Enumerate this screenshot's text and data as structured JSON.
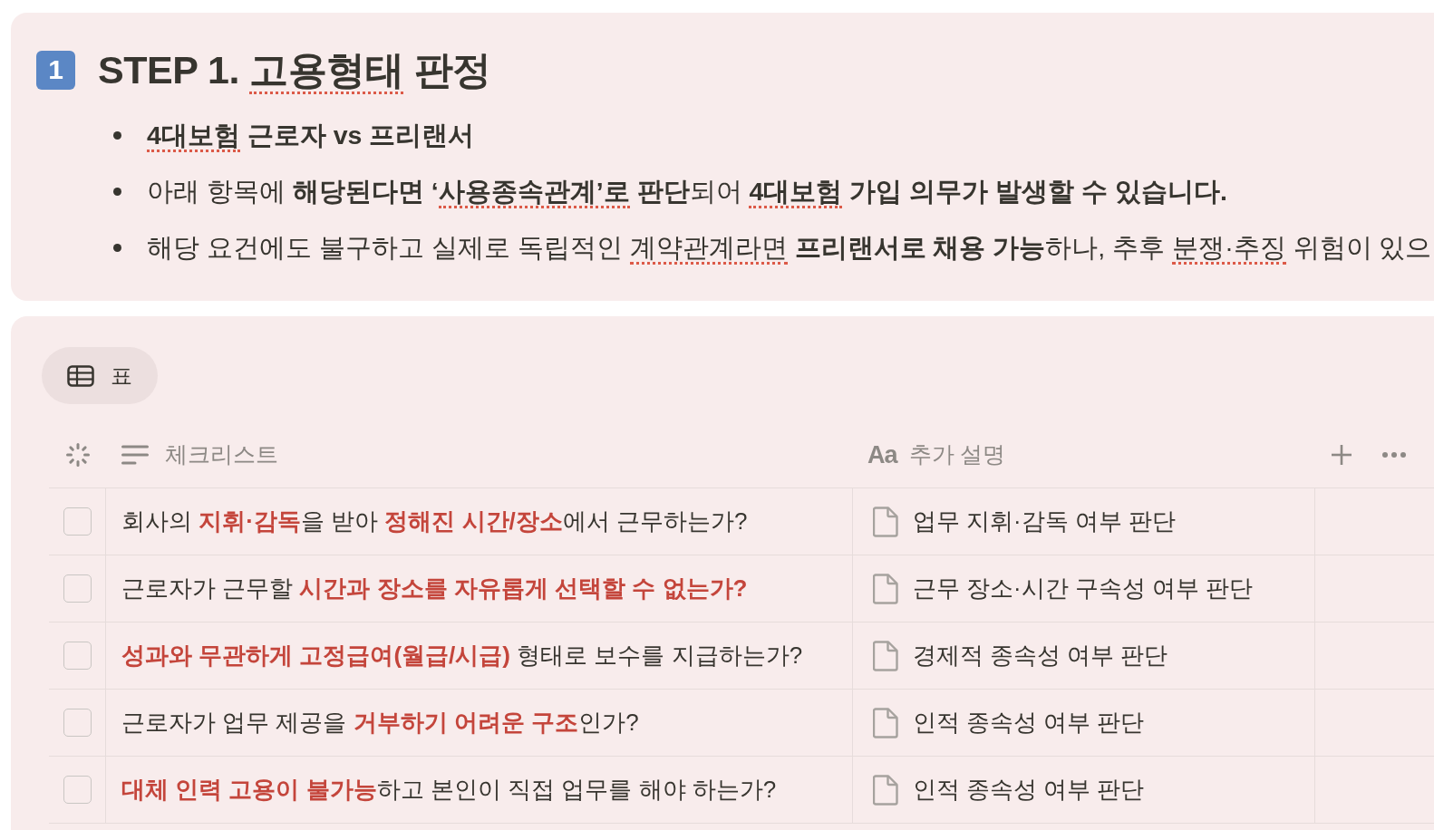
{
  "step_section": {
    "badge": "1",
    "title": [
      {
        "text": "STEP 1. ",
        "misspelled": false
      },
      {
        "text": "고용형태",
        "misspelled": true
      },
      {
        "text": " 판정",
        "misspelled": false
      }
    ],
    "bullets": [
      {
        "runs": [
          {
            "text": "4대보험",
            "bold": true,
            "misspelled": true
          },
          {
            "text": " 근로자 vs 프리랜서",
            "bold": true,
            "misspelled": false
          }
        ]
      },
      {
        "runs": [
          {
            "text": "아래 항목에 ",
            "bold": false,
            "misspelled": false
          },
          {
            "text": "해당된다면 ‘",
            "bold": true,
            "misspelled": false
          },
          {
            "text": "사용종속관계’로",
            "bold": true,
            "misspelled": true
          },
          {
            "text": " 판단",
            "bold": true,
            "misspelled": false
          },
          {
            "text": "되어 ",
            "bold": false,
            "misspelled": false
          },
          {
            "text": "4대보험",
            "bold": true,
            "misspelled": true
          },
          {
            "text": " 가입 의무가 발생할 수 있습니다.",
            "bold": true,
            "misspelled": false
          }
        ]
      },
      {
        "runs": [
          {
            "text": "해당 요건에도 불구하고 실제로 독립적인 ",
            "bold": false,
            "misspelled": false
          },
          {
            "text": "계약관계라면",
            "bold": false,
            "misspelled": true
          },
          {
            "text": " 프리랜서로 채용 가능",
            "bold": true,
            "misspelled": false
          },
          {
            "text": "하나, 추후 ",
            "bold": false,
            "misspelled": false
          },
          {
            "text": "분쟁·추징",
            "bold": false,
            "misspelled": true
          },
          {
            "text": " 위험이 있으",
            "bold": false,
            "misspelled": false
          }
        ]
      }
    ]
  },
  "checklist": {
    "views": [
      {
        "label": "표",
        "selected": true
      }
    ],
    "columns": [
      {
        "kind": "checkbox"
      },
      {
        "kind": "text",
        "label": "체크리스트"
      },
      {
        "kind": "title",
        "icon": "Aa",
        "label": "추가 설명"
      }
    ],
    "rows": [
      {
        "checked": false,
        "question": "회사의 **지휘·감독**을 받아 **정해진 시간/장소**에서 근무하는가?",
        "description": "업무 지휘·감독 여부 판단"
      },
      {
        "checked": false,
        "question": "근로자가 근무할 **시간과 장소를 자유롭게 선택할 수 없는가?**",
        "description": "근무 장소·시간 구속성 여부 판단"
      },
      {
        "checked": false,
        "question": "**성과와 무관하게 고정급여(월급/시급)** 형태로 보수를 지급하는가?",
        "description": "경제적 종속성 여부 판단"
      },
      {
        "checked": false,
        "question": "근로자가 업무 제공을 **거부하기 어려운 구조**인가?",
        "description": "인적 종속성 여부 판단"
      },
      {
        "checked": false,
        "question": "**대체 인력 고용이 불가능**하고 본인이 직접 업무를 해야 하는가?",
        "description": "인적 종속성 여부 판단"
      }
    ]
  }
}
